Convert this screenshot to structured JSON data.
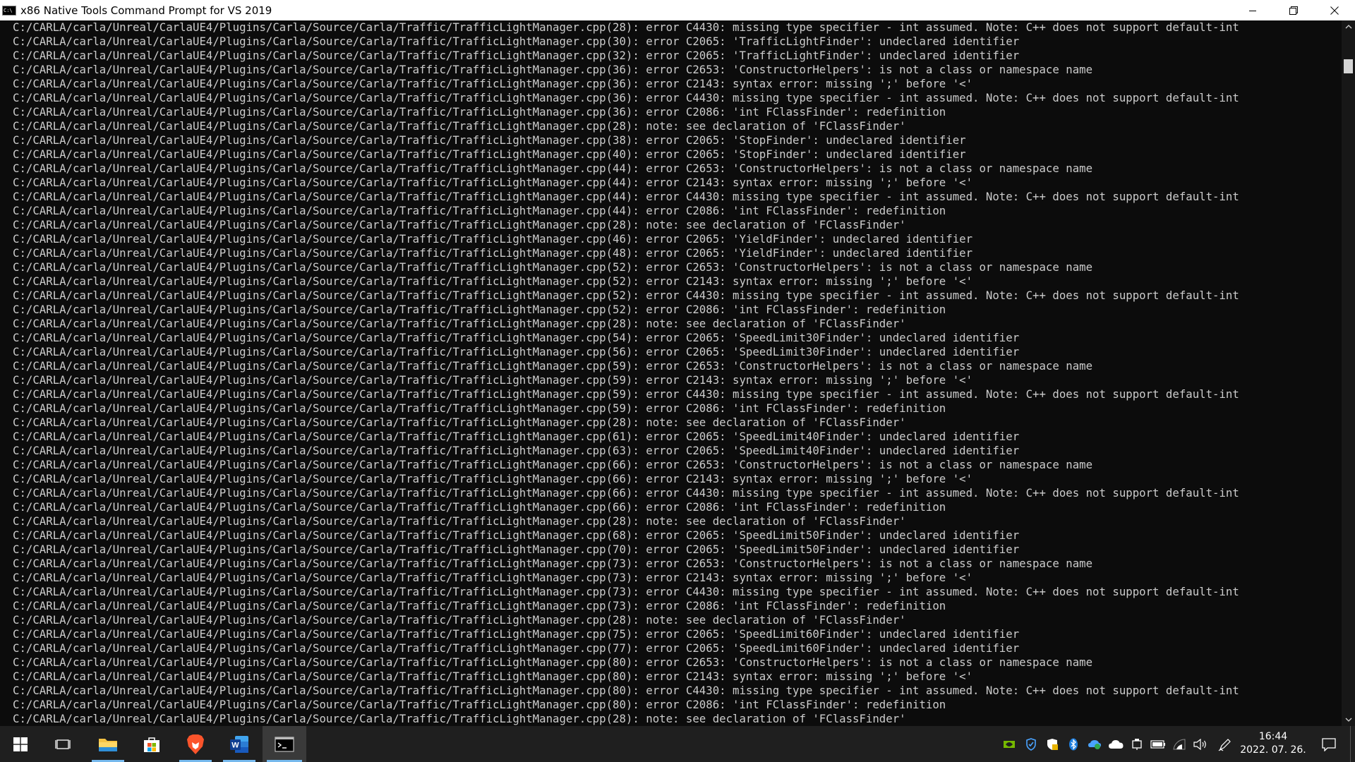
{
  "window": {
    "title": "x86 Native Tools Command Prompt for VS 2019",
    "icon_text": "C:\\"
  },
  "console": {
    "lines": [
      "C:/CARLA/carla/Unreal/CarlaUE4/Plugins/Carla/Source/Carla/Traffic/TrafficLightManager.cpp(28): error C4430: missing type specifier - int assumed. Note: C++ does not support default-int",
      "C:/CARLA/carla/Unreal/CarlaUE4/Plugins/Carla/Source/Carla/Traffic/TrafficLightManager.cpp(30): error C2065: 'TrafficLightFinder': undeclared identifier",
      "C:/CARLA/carla/Unreal/CarlaUE4/Plugins/Carla/Source/Carla/Traffic/TrafficLightManager.cpp(32): error C2065: 'TrafficLightFinder': undeclared identifier",
      "C:/CARLA/carla/Unreal/CarlaUE4/Plugins/Carla/Source/Carla/Traffic/TrafficLightManager.cpp(36): error C2653: 'ConstructorHelpers': is not a class or namespace name",
      "C:/CARLA/carla/Unreal/CarlaUE4/Plugins/Carla/Source/Carla/Traffic/TrafficLightManager.cpp(36): error C2143: syntax error: missing ';' before '<'",
      "C:/CARLA/carla/Unreal/CarlaUE4/Plugins/Carla/Source/Carla/Traffic/TrafficLightManager.cpp(36): error C4430: missing type specifier - int assumed. Note: C++ does not support default-int",
      "C:/CARLA/carla/Unreal/CarlaUE4/Plugins/Carla/Source/Carla/Traffic/TrafficLightManager.cpp(36): error C2086: 'int FClassFinder': redefinition",
      "C:/CARLA/carla/Unreal/CarlaUE4/Plugins/Carla/Source/Carla/Traffic/TrafficLightManager.cpp(28): note: see declaration of 'FClassFinder'",
      "C:/CARLA/carla/Unreal/CarlaUE4/Plugins/Carla/Source/Carla/Traffic/TrafficLightManager.cpp(38): error C2065: 'StopFinder': undeclared identifier",
      "C:/CARLA/carla/Unreal/CarlaUE4/Plugins/Carla/Source/Carla/Traffic/TrafficLightManager.cpp(40): error C2065: 'StopFinder': undeclared identifier",
      "C:/CARLA/carla/Unreal/CarlaUE4/Plugins/Carla/Source/Carla/Traffic/TrafficLightManager.cpp(44): error C2653: 'ConstructorHelpers': is not a class or namespace name",
      "C:/CARLA/carla/Unreal/CarlaUE4/Plugins/Carla/Source/Carla/Traffic/TrafficLightManager.cpp(44): error C2143: syntax error: missing ';' before '<'",
      "C:/CARLA/carla/Unreal/CarlaUE4/Plugins/Carla/Source/Carla/Traffic/TrafficLightManager.cpp(44): error C4430: missing type specifier - int assumed. Note: C++ does not support default-int",
      "C:/CARLA/carla/Unreal/CarlaUE4/Plugins/Carla/Source/Carla/Traffic/TrafficLightManager.cpp(44): error C2086: 'int FClassFinder': redefinition",
      "C:/CARLA/carla/Unreal/CarlaUE4/Plugins/Carla/Source/Carla/Traffic/TrafficLightManager.cpp(28): note: see declaration of 'FClassFinder'",
      "C:/CARLA/carla/Unreal/CarlaUE4/Plugins/Carla/Source/Carla/Traffic/TrafficLightManager.cpp(46): error C2065: 'YieldFinder': undeclared identifier",
      "C:/CARLA/carla/Unreal/CarlaUE4/Plugins/Carla/Source/Carla/Traffic/TrafficLightManager.cpp(48): error C2065: 'YieldFinder': undeclared identifier",
      "C:/CARLA/carla/Unreal/CarlaUE4/Plugins/Carla/Source/Carla/Traffic/TrafficLightManager.cpp(52): error C2653: 'ConstructorHelpers': is not a class or namespace name",
      "C:/CARLA/carla/Unreal/CarlaUE4/Plugins/Carla/Source/Carla/Traffic/TrafficLightManager.cpp(52): error C2143: syntax error: missing ';' before '<'",
      "C:/CARLA/carla/Unreal/CarlaUE4/Plugins/Carla/Source/Carla/Traffic/TrafficLightManager.cpp(52): error C4430: missing type specifier - int assumed. Note: C++ does not support default-int",
      "C:/CARLA/carla/Unreal/CarlaUE4/Plugins/Carla/Source/Carla/Traffic/TrafficLightManager.cpp(52): error C2086: 'int FClassFinder': redefinition",
      "C:/CARLA/carla/Unreal/CarlaUE4/Plugins/Carla/Source/Carla/Traffic/TrafficLightManager.cpp(28): note: see declaration of 'FClassFinder'",
      "C:/CARLA/carla/Unreal/CarlaUE4/Plugins/Carla/Source/Carla/Traffic/TrafficLightManager.cpp(54): error C2065: 'SpeedLimit30Finder': undeclared identifier",
      "C:/CARLA/carla/Unreal/CarlaUE4/Plugins/Carla/Source/Carla/Traffic/TrafficLightManager.cpp(56): error C2065: 'SpeedLimit30Finder': undeclared identifier",
      "C:/CARLA/carla/Unreal/CarlaUE4/Plugins/Carla/Source/Carla/Traffic/TrafficLightManager.cpp(59): error C2653: 'ConstructorHelpers': is not a class or namespace name",
      "C:/CARLA/carla/Unreal/CarlaUE4/Plugins/Carla/Source/Carla/Traffic/TrafficLightManager.cpp(59): error C2143: syntax error: missing ';' before '<'",
      "C:/CARLA/carla/Unreal/CarlaUE4/Plugins/Carla/Source/Carla/Traffic/TrafficLightManager.cpp(59): error C4430: missing type specifier - int assumed. Note: C++ does not support default-int",
      "C:/CARLA/carla/Unreal/CarlaUE4/Plugins/Carla/Source/Carla/Traffic/TrafficLightManager.cpp(59): error C2086: 'int FClassFinder': redefinition",
      "C:/CARLA/carla/Unreal/CarlaUE4/Plugins/Carla/Source/Carla/Traffic/TrafficLightManager.cpp(28): note: see declaration of 'FClassFinder'",
      "C:/CARLA/carla/Unreal/CarlaUE4/Plugins/Carla/Source/Carla/Traffic/TrafficLightManager.cpp(61): error C2065: 'SpeedLimit40Finder': undeclared identifier",
      "C:/CARLA/carla/Unreal/CarlaUE4/Plugins/Carla/Source/Carla/Traffic/TrafficLightManager.cpp(63): error C2065: 'SpeedLimit40Finder': undeclared identifier",
      "C:/CARLA/carla/Unreal/CarlaUE4/Plugins/Carla/Source/Carla/Traffic/TrafficLightManager.cpp(66): error C2653: 'ConstructorHelpers': is not a class or namespace name",
      "C:/CARLA/carla/Unreal/CarlaUE4/Plugins/Carla/Source/Carla/Traffic/TrafficLightManager.cpp(66): error C2143: syntax error: missing ';' before '<'",
      "C:/CARLA/carla/Unreal/CarlaUE4/Plugins/Carla/Source/Carla/Traffic/TrafficLightManager.cpp(66): error C4430: missing type specifier - int assumed. Note: C++ does not support default-int",
      "C:/CARLA/carla/Unreal/CarlaUE4/Plugins/Carla/Source/Carla/Traffic/TrafficLightManager.cpp(66): error C2086: 'int FClassFinder': redefinition",
      "C:/CARLA/carla/Unreal/CarlaUE4/Plugins/Carla/Source/Carla/Traffic/TrafficLightManager.cpp(28): note: see declaration of 'FClassFinder'",
      "C:/CARLA/carla/Unreal/CarlaUE4/Plugins/Carla/Source/Carla/Traffic/TrafficLightManager.cpp(68): error C2065: 'SpeedLimit50Finder': undeclared identifier",
      "C:/CARLA/carla/Unreal/CarlaUE4/Plugins/Carla/Source/Carla/Traffic/TrafficLightManager.cpp(70): error C2065: 'SpeedLimit50Finder': undeclared identifier",
      "C:/CARLA/carla/Unreal/CarlaUE4/Plugins/Carla/Source/Carla/Traffic/TrafficLightManager.cpp(73): error C2653: 'ConstructorHelpers': is not a class or namespace name",
      "C:/CARLA/carla/Unreal/CarlaUE4/Plugins/Carla/Source/Carla/Traffic/TrafficLightManager.cpp(73): error C2143: syntax error: missing ';' before '<'",
      "C:/CARLA/carla/Unreal/CarlaUE4/Plugins/Carla/Source/Carla/Traffic/TrafficLightManager.cpp(73): error C4430: missing type specifier - int assumed. Note: C++ does not support default-int",
      "C:/CARLA/carla/Unreal/CarlaUE4/Plugins/Carla/Source/Carla/Traffic/TrafficLightManager.cpp(73): error C2086: 'int FClassFinder': redefinition",
      "C:/CARLA/carla/Unreal/CarlaUE4/Plugins/Carla/Source/Carla/Traffic/TrafficLightManager.cpp(28): note: see declaration of 'FClassFinder'",
      "C:/CARLA/carla/Unreal/CarlaUE4/Plugins/Carla/Source/Carla/Traffic/TrafficLightManager.cpp(75): error C2065: 'SpeedLimit60Finder': undeclared identifier",
      "C:/CARLA/carla/Unreal/CarlaUE4/Plugins/Carla/Source/Carla/Traffic/TrafficLightManager.cpp(77): error C2065: 'SpeedLimit60Finder': undeclared identifier",
      "C:/CARLA/carla/Unreal/CarlaUE4/Plugins/Carla/Source/Carla/Traffic/TrafficLightManager.cpp(80): error C2653: 'ConstructorHelpers': is not a class or namespace name",
      "C:/CARLA/carla/Unreal/CarlaUE4/Plugins/Carla/Source/Carla/Traffic/TrafficLightManager.cpp(80): error C2143: syntax error: missing ';' before '<'",
      "C:/CARLA/carla/Unreal/CarlaUE4/Plugins/Carla/Source/Carla/Traffic/TrafficLightManager.cpp(80): error C4430: missing type specifier - int assumed. Note: C++ does not support default-int",
      "C:/CARLA/carla/Unreal/CarlaUE4/Plugins/Carla/Source/Carla/Traffic/TrafficLightManager.cpp(80): error C2086: 'int FClassFinder': redefinition",
      "C:/CARLA/carla/Unreal/CarlaUE4/Plugins/Carla/Source/Carla/Traffic/TrafficLightManager.cpp(28): note: see declaration of 'FClassFinder'"
    ]
  },
  "taskbar": {
    "apps": [
      {
        "name": "start",
        "icon": "windows-logo-icon",
        "active": false
      },
      {
        "name": "task-view",
        "icon": "task-view-icon",
        "active": false
      },
      {
        "name": "file-explorer",
        "icon": "folder-icon",
        "active": false
      },
      {
        "name": "microsoft-store",
        "icon": "store-icon",
        "active": false
      },
      {
        "name": "brave",
        "icon": "brave-lion-icon",
        "active": false
      },
      {
        "name": "word",
        "icon": "word-icon",
        "active": false,
        "icon_text": "W"
      },
      {
        "name": "command-prompt",
        "icon": "terminal-icon",
        "active": true
      }
    ],
    "tray_icons": [
      "nvidia-icon",
      "defender-shield-icon",
      "security-shield-icon",
      "bluetooth-icon",
      "network-sync-icon",
      "onedrive-cloud-icon",
      "device-icon",
      "battery-icon",
      "wifi-icon",
      "volume-icon",
      "pen-icon"
    ],
    "clock": {
      "time": "16:44",
      "date": "2022. 07. 26."
    }
  },
  "colors": {
    "console_bg": "#0c0c0c",
    "console_fg": "#cccccc",
    "taskbar_bg": "#1f1f1f",
    "accent": "#76b9ed"
  }
}
